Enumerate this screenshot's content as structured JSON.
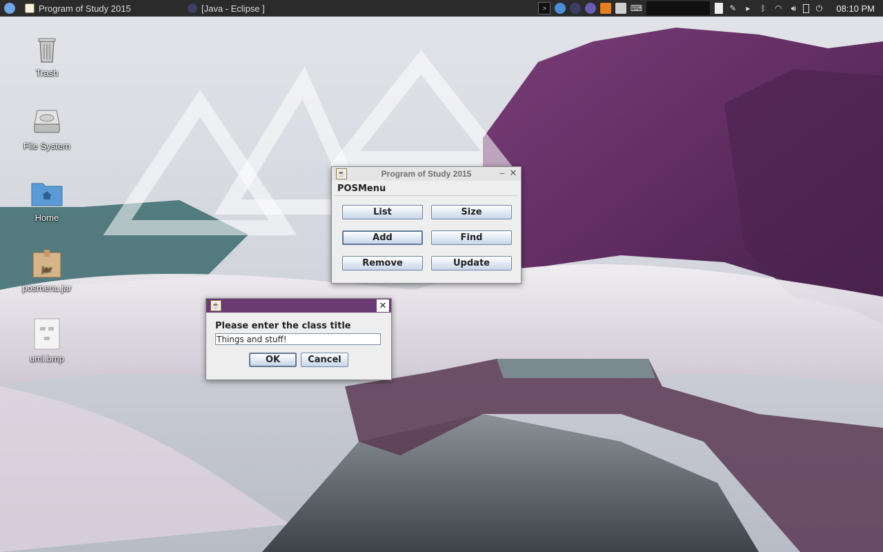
{
  "panel": {
    "menu_icon": "xfce-mouse-icon",
    "tasks": [
      {
        "label": "Program of Study 2015",
        "icon": "java-app-icon"
      },
      {
        "label": "[Java - Eclipse ]",
        "icon": "eclipse-icon"
      }
    ],
    "tray_icons": [
      "terminal-icon",
      "chromium-icon",
      "eclipse-icon",
      "emacs-icon",
      "sublime-icon",
      "file-manager-icon",
      "keyboard-icon",
      "workspace-switcher",
      "note-icon",
      "arrow-icon",
      "bluetooth-icon",
      "wifi-icon",
      "volume-icon",
      "battery-icon",
      "power-icon"
    ],
    "clock": "08:10 PM"
  },
  "desktop": {
    "icons": [
      {
        "label": "Trash",
        "icon": "trash-icon"
      },
      {
        "label": "File System",
        "icon": "hard-drive-icon"
      },
      {
        "label": "Home",
        "icon": "home-folder-icon"
      },
      {
        "label": "posmenu.jar",
        "icon": "jar-file-icon"
      },
      {
        "label": "uml.bmp",
        "icon": "image-file-icon"
      }
    ]
  },
  "pos_window": {
    "title": "Program of Study 2015",
    "menu": "POSMenu",
    "buttons": {
      "list": "List",
      "size": "Size",
      "add": "Add",
      "find": "Find",
      "remove": "Remove",
      "update": "Update"
    }
  },
  "input_dialog": {
    "title": "",
    "prompt": "Please enter the class title",
    "value": "Things and stuff!",
    "ok": "OK",
    "cancel": "Cancel"
  },
  "colors": {
    "panel": "#2b2b2b",
    "dialog_titlebar": "#6a3b73",
    "button_border": "#6f86a6"
  }
}
